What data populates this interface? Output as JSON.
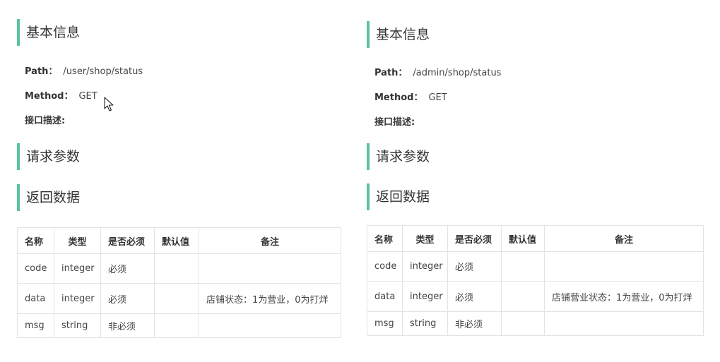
{
  "left": {
    "basic_title": "基本信息",
    "path_label": "Path：",
    "path_value": "/user/shop/status",
    "method_label": "Method：",
    "method_value": "GET",
    "desc_label": "接口描述:",
    "request_title": "请求参数",
    "response_title": "返回数据",
    "table": {
      "headers": [
        "名称",
        "类型",
        "是否必须",
        "默认值",
        "备注"
      ],
      "rows": [
        [
          "code",
          "integer",
          "必须",
          "",
          ""
        ],
        [
          "data",
          "integer",
          "必须",
          "",
          "店铺状态：1为营业，0为打烊"
        ],
        [
          "msg",
          "string",
          "非必须",
          "",
          ""
        ]
      ]
    }
  },
  "right": {
    "basic_title": "基本信息",
    "path_label": "Path：",
    "path_value": "/admin/shop/status",
    "method_label": "Method：",
    "method_value": "GET",
    "desc_label": "接口描述:",
    "request_title": "请求参数",
    "response_title": "返回数据",
    "table": {
      "headers": [
        "名称",
        "类型",
        "是否必须",
        "默认值",
        "备注"
      ],
      "rows": [
        [
          "code",
          "integer",
          "必须",
          "",
          ""
        ],
        [
          "data",
          "integer",
          "必须",
          "",
          "店铺营业状态：1为营业，0为打烊"
        ],
        [
          "msg",
          "string",
          "非必须",
          "",
          ""
        ]
      ]
    }
  },
  "colors": {
    "accent": "#58c39d",
    "border": "#e3e3e3"
  },
  "icons": {
    "cursor": "mouse-pointer-icon"
  }
}
